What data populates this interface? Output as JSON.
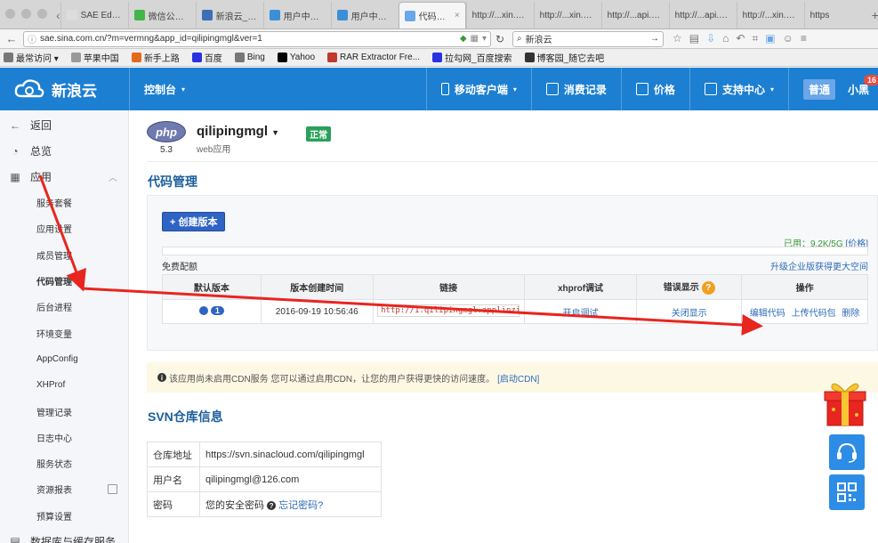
{
  "browser": {
    "tabs": [
      {
        "label": "SAE Editor",
        "icon_color": "#dcdcdc"
      },
      {
        "label": "微信公众...",
        "icon_color": "#44b549"
      },
      {
        "label": "新浪云_百...",
        "icon_color": "#3b6fb6"
      },
      {
        "label": "用户中心 ...",
        "icon_color": "#3b8fd6"
      },
      {
        "label": "用户中心 ...",
        "icon_color": "#3b8fd6"
      },
      {
        "label": "代码管...",
        "icon_color": "#6aa6e8",
        "active": true
      },
      {
        "label": "http://...xin.php",
        "icon_color": ""
      },
      {
        "label": "http://...xin.php",
        "icon_color": ""
      },
      {
        "label": "http://...api.php",
        "icon_color": ""
      },
      {
        "label": "http://...api.php",
        "icon_color": ""
      },
      {
        "label": "http://...xin.php",
        "icon_color": ""
      },
      {
        "label": "https",
        "icon_color": ""
      }
    ],
    "url": "sae.sina.com.cn/?m=vermng&app_id=qilipingmgl&ver=1",
    "search_query": "新浪云",
    "bookmarks": [
      {
        "label": "最常访问 ▾",
        "color": "#777"
      },
      {
        "label": "苹果中国",
        "color": "#999"
      },
      {
        "label": "新手上路",
        "color": "#e46a1b"
      },
      {
        "label": "百度",
        "color": "#2932e1"
      },
      {
        "label": "Bing",
        "color": "#777"
      },
      {
        "label": "Yahoo",
        "color": "#000"
      },
      {
        "label": "RAR Extractor Fre...",
        "color": "#c0392b"
      },
      {
        "label": "拉勾网_百度搜索",
        "color": "#2932e1"
      },
      {
        "label": "博客园_随它去吧",
        "color": "#333"
      }
    ]
  },
  "header": {
    "logo": "新浪云",
    "console": "控制台",
    "mobile": "移动客户端",
    "billing": "消费记录",
    "price": "价格",
    "support": "支持中心",
    "level": "普通",
    "user": "小黑",
    "notif_count": "16"
  },
  "sidebar": {
    "back": "返回",
    "overview": "总览",
    "app": "应用",
    "items": [
      "服务套餐",
      "应用设置",
      "成员管理",
      "代码管理",
      "后台进程",
      "环境变量",
      "AppConfig",
      "XHProf",
      "管理记录",
      "日志中心",
      "服务状态",
      "资源报表",
      "预算设置"
    ],
    "bottom": "数据库与缓存服务"
  },
  "app": {
    "runtime": "php",
    "version": "5.3",
    "name": "qilipingmgl",
    "type": "web应用",
    "status": "正常"
  },
  "code": {
    "title": "代码管理",
    "create_button": "+ 创建版本",
    "quota_used": "已用：9.2K/5G",
    "quota_fraction": 0.0,
    "quota_price_link": "[价格]",
    "quota_label": "免费配额",
    "upgrade_link": "升级企业版获得更大空间",
    "columns": [
      "默认版本",
      "版本创建时间",
      "链接",
      "xhprof调试",
      "错误显示",
      "操作"
    ],
    "rows": [
      {
        "version": "1",
        "created": "2016-09-19 10:56:46",
        "link": "http://1.qilipingmgl.applinzi.com",
        "xhprof": "开启调试",
        "error_display": "关闭显示",
        "op_edit": "编辑代码",
        "op_upload": "上传代码包",
        "op_delete": "删除"
      }
    ]
  },
  "cdn": {
    "notice": "该应用尚未启用CDN服务 您可以通过启用CDN，让您的用户获得更快的访问速度。",
    "link": "[启动CDN]"
  },
  "svn": {
    "title": "SVN仓库信息",
    "rows": [
      {
        "key": "仓库地址",
        "value": "https://svn.sinacloud.com/qilipingmgl"
      },
      {
        "key": "用户名",
        "value": "qilipingmgl@126.com"
      },
      {
        "key": "密码",
        "value": "您的安全密码",
        "link": "忘记密码?"
      }
    ]
  },
  "colors": {
    "brand": "#1d7fd1",
    "annotation": "#e8251f",
    "link": "#2d6bb8"
  }
}
